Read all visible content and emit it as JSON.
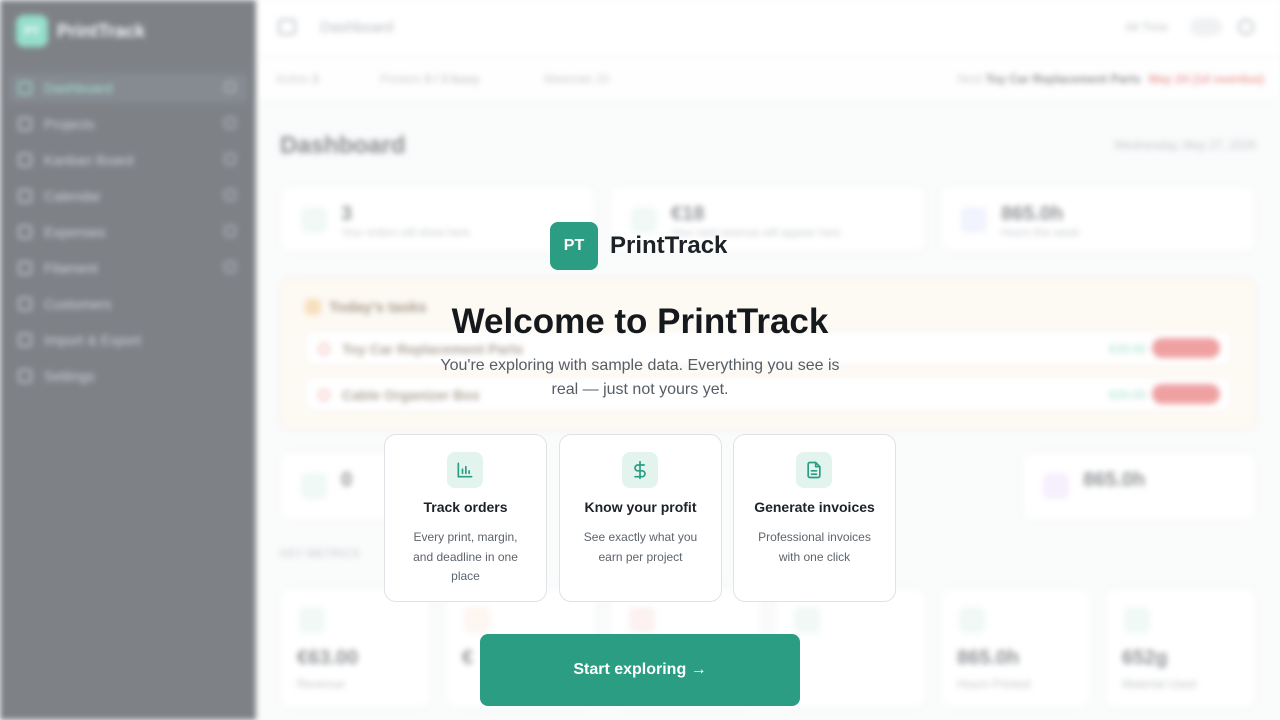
{
  "app": {
    "logo_initials": "PT",
    "name": "PrintTrack"
  },
  "sidebar": {
    "items": [
      {
        "label": "Dashboard"
      },
      {
        "label": "Projects"
      },
      {
        "label": "Kanban Board"
      },
      {
        "label": "Calendar"
      },
      {
        "label": "Expenses"
      },
      {
        "label": "Filament"
      },
      {
        "label": "Customers"
      },
      {
        "label": "Import & Export"
      },
      {
        "label": "Settings"
      }
    ]
  },
  "topbar": {
    "title": "Dashboard",
    "time_label": "All Time"
  },
  "statusbar": {
    "active_label": "Active",
    "active_count": "3",
    "printers_label": "Printers",
    "printers_value": "0 / 3 busy",
    "materials_label": "Materials",
    "materials_value": "20",
    "next_label": "Next",
    "next_project": "Toy Car Replacement Parts",
    "next_due": "May 24 (1d overdue)"
  },
  "dashboard": {
    "title": "Dashboard",
    "date": "Wednesday, May 27, 2026",
    "stats": [
      {
        "value": "3",
        "sub": "Your orders will show here"
      },
      {
        "value": "€18",
        "sub": "Your next revenue will appear here"
      },
      {
        "value": "865.0h",
        "sub": "Hours this week"
      }
    ],
    "tasks_title": "Today's tasks",
    "tasks": [
      {
        "name": "Toy Car Replacement Parts",
        "amount": "€20.00"
      },
      {
        "name": "Cable Organizer Box",
        "amount": "€20.00"
      }
    ],
    "mid_stats": [
      {
        "value": "0"
      },
      {
        "value": "865.0h"
      }
    ],
    "metrics_label": "KEY METRICS",
    "metrics": [
      {
        "value": "€63.00",
        "label": "Revenue"
      },
      {
        "value": "€",
        "label": ""
      },
      {
        "value": "",
        "label": ""
      },
      {
        "value": "",
        "label": ""
      },
      {
        "value": "865.0h",
        "label": "Hours Printed"
      },
      {
        "value": "652g",
        "label": "Material Used"
      }
    ]
  },
  "welcome": {
    "logo_initials": "PT",
    "brand": "PrintTrack",
    "title": "Welcome to PrintTrack",
    "subtitle": "You're exploring with sample data. Everything you see is real — just not yours yet.",
    "features": [
      {
        "icon": "bar-chart-icon",
        "title": "Track orders",
        "desc": "Every print, margin, and deadline in one place"
      },
      {
        "icon": "dollar-icon",
        "title": "Know your profit",
        "desc": "See exactly what you earn per project"
      },
      {
        "icon": "document-icon",
        "title": "Generate invoices",
        "desc": "Professional invoices with one click"
      }
    ],
    "cta_label": "Start exploring →"
  },
  "colors": {
    "accent": "#2a9d82",
    "sidebar_bg": "#151b24",
    "danger": "#e25555"
  }
}
